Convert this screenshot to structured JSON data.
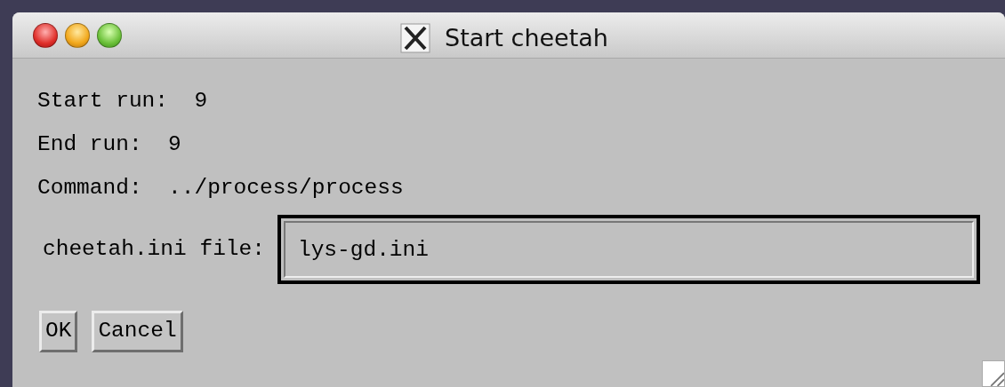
{
  "window": {
    "title": "Start cheetah"
  },
  "info": [
    {
      "label": "Start run:",
      "value": "9"
    },
    {
      "label": "End run:",
      "value": "9"
    },
    {
      "label": "Command:",
      "value": "../process/process"
    }
  ],
  "ini_file": {
    "label": "cheetah.ini file:",
    "value": "lys-gd.ini"
  },
  "buttons": [
    {
      "label": "OK"
    },
    {
      "label": "Cancel"
    }
  ]
}
